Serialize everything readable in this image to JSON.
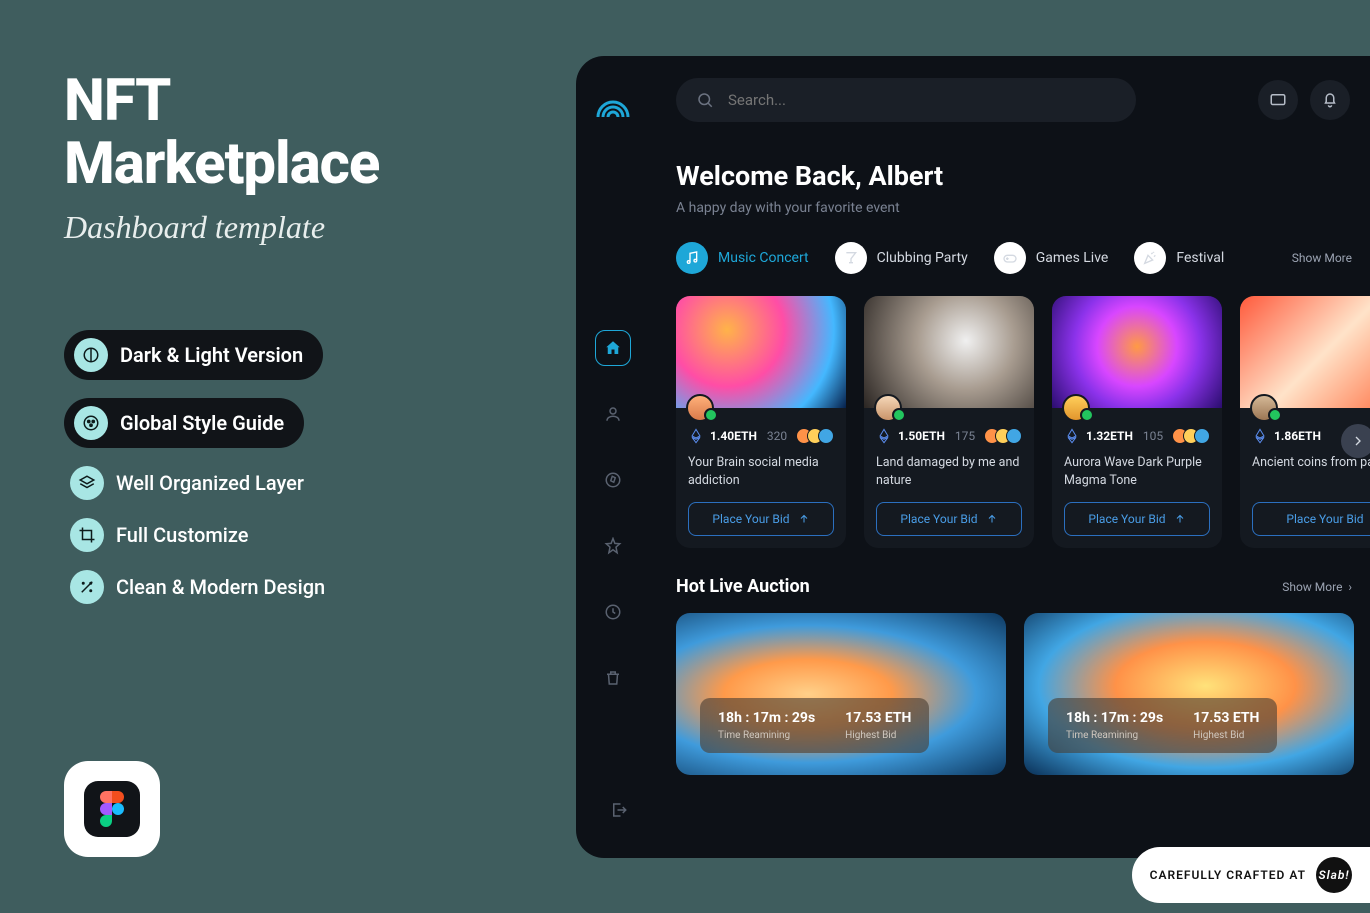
{
  "promo": {
    "title_line1": "NFT",
    "title_line2": "Marketplace",
    "subtitle": "Dashboard template",
    "features": [
      {
        "label": "Dark & Light Version",
        "style": "dark"
      },
      {
        "label": "Global Style Guide",
        "style": "dark"
      },
      {
        "label": "Well Organized Layer",
        "style": "plain"
      },
      {
        "label": "Full Customize",
        "style": "plain"
      },
      {
        "label": "Clean & Modern Design",
        "style": "plain"
      }
    ]
  },
  "search": {
    "placeholder": "Search..."
  },
  "welcome": {
    "title": "Welcome Back, Albert",
    "subtitle": "A happy day with your favorite event"
  },
  "categories": {
    "items": [
      "Music Concert",
      "Clubbing Party",
      "Games Live",
      "Festival"
    ],
    "show_more": "Show More"
  },
  "cards": [
    {
      "price": "1.40ETH",
      "count": "320",
      "title": "Your Brain social media addiction",
      "btn": "Place Your Bid"
    },
    {
      "price": "1.50ETH",
      "count": "175",
      "title": "Land damaged by me and nature",
      "btn": "Place Your Bid"
    },
    {
      "price": "1.32ETH",
      "count": "105",
      "title": "Aurora Wave Dark Purple Magma Tone",
      "btn": "Place Your Bid"
    },
    {
      "price": "1.86ETH",
      "count": "",
      "title": "Ancient coins from past",
      "btn": "Place Your Bid"
    }
  ],
  "hot_auction": {
    "title": "Hot Live Auction",
    "show_more": "Show More",
    "items": [
      {
        "time": "18h : 17m : 29s",
        "time_label": "Time Reamining",
        "bid": "17.53 ETH",
        "bid_label": "Highest Bid"
      },
      {
        "time": "18h : 17m : 29s",
        "time_label": "Time Reamining",
        "bid": "17.53 ETH",
        "bid_label": "Highest Bid"
      }
    ]
  },
  "crafted": {
    "label": "CAREFULLY CRAFTED AT",
    "brand": "Slab!"
  }
}
